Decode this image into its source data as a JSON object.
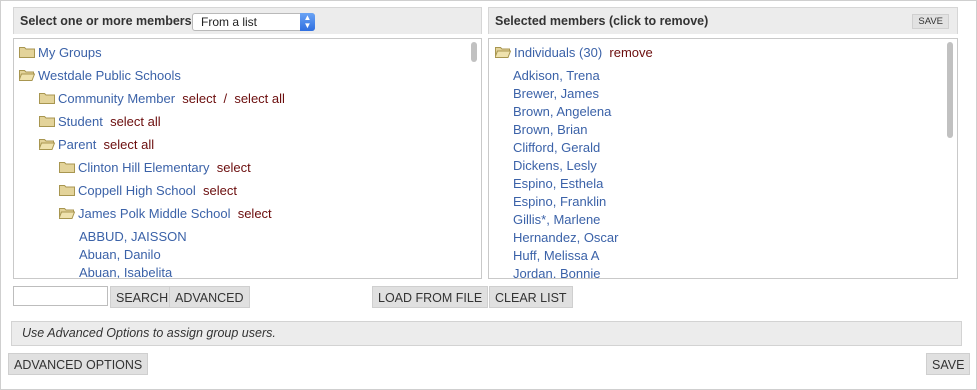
{
  "left_panel": {
    "title": "Select one or more members",
    "source_select": {
      "value": "From a list",
      "arrows": "▲▼"
    },
    "tree": [
      {
        "label": "My Groups",
        "actions": []
      },
      {
        "label": "Westdale Public Schools",
        "actions": []
      },
      {
        "label": "Community Member",
        "actions": [
          "select",
          "/",
          "select all"
        ]
      },
      {
        "label": "Student",
        "actions": [
          "select all"
        ]
      },
      {
        "label": "Parent",
        "actions": [
          "select all"
        ]
      },
      {
        "label": "Clinton Hill Elementary",
        "actions": [
          "select"
        ]
      },
      {
        "label": "Coppell High School",
        "actions": [
          "select"
        ]
      },
      {
        "label": "James Polk Middle School",
        "actions": [
          "select"
        ]
      }
    ],
    "people": [
      "ABBUD, JAISSON",
      "Abuan, Danilo",
      "Abuan, Isabelita"
    ]
  },
  "right_panel": {
    "title": "Selected members (click to remove)",
    "save_label": "SAVE",
    "group_label": "Individuals (30)",
    "remove_label": "remove",
    "members": [
      "Adkison, Trena",
      "Brewer, James",
      "Brown, Angelena",
      "Brown, Brian",
      "Clifford, Gerald",
      "Dickens, Lesly",
      "Espino, Esthela",
      "Espino, Franklin",
      "Gillis*, Marlene",
      "Hernandez, Oscar",
      "Huff, Melissa A",
      "Jordan, Bonnie"
    ]
  },
  "toolbar": {
    "search_label": "SEARCH",
    "advanced_label": "ADVANCED",
    "load_label": "LOAD FROM FILE",
    "clear_label": "CLEAR LIST"
  },
  "hint": "Use Advanced Options to assign group users.",
  "footer": {
    "advanced_options_label": "ADVANCED OPTIONS",
    "save_label": "SAVE"
  },
  "colors": {
    "link": "#3b62a8",
    "action": "#6b0d0d",
    "folder": "#d8c78a"
  }
}
